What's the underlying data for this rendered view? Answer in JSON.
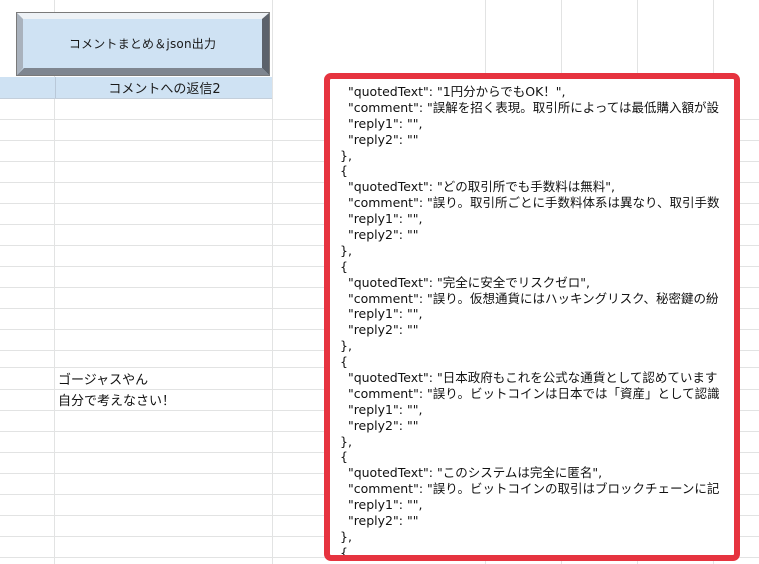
{
  "macro_button": {
    "label": "コメントまとめ＆json出力"
  },
  "header": {
    "column_title": "コメントへの返信2"
  },
  "cells": {
    "row1": "ゴージャスやん",
    "row2": "自分で考えなさい！"
  },
  "json_panel": {
    "lines": [
      "  \"quotedText\": \"1円分からでもOK！\",",
      "  \"comment\": \"誤解を招く表現。取引所によっては最低購入額が設",
      "  \"reply1\": \"\",",
      "  \"reply2\": \"\"",
      "},",
      "{",
      "  \"quotedText\": \"どの取引所でも手数料は無料\",",
      "  \"comment\": \"誤り。取引所ごとに手数料体系は異なり、取引手数",
      "  \"reply1\": \"\",",
      "  \"reply2\": \"\"",
      "},",
      "{",
      "  \"quotedText\": \"完全に安全でリスクゼロ\",",
      "  \"comment\": \"誤り。仮想通貨にはハッキングリスク、秘密鍵の紛",
      "  \"reply1\": \"\",",
      "  \"reply2\": \"\"",
      "},",
      "{",
      "  \"quotedText\": \"日本政府もこれを公式な通貨として認めています",
      "  \"comment\": \"誤り。ビットコインは日本では「資産」として認識",
      "  \"reply1\": \"\",",
      "  \"reply2\": \"\"",
      "},",
      "{",
      "  \"quotedText\": \"このシステムは完全に匿名\",",
      "  \"comment\": \"誤り。ビットコインの取引はブロックチェーンに記",
      "  \"reply1\": \"\",",
      "  \"reply2\": \"\"",
      "},",
      "{"
    ]
  },
  "colors": {
    "header_fill": "#cfe2f3",
    "panel_border": "#e6333f",
    "gridline": "#e2e3e3"
  }
}
